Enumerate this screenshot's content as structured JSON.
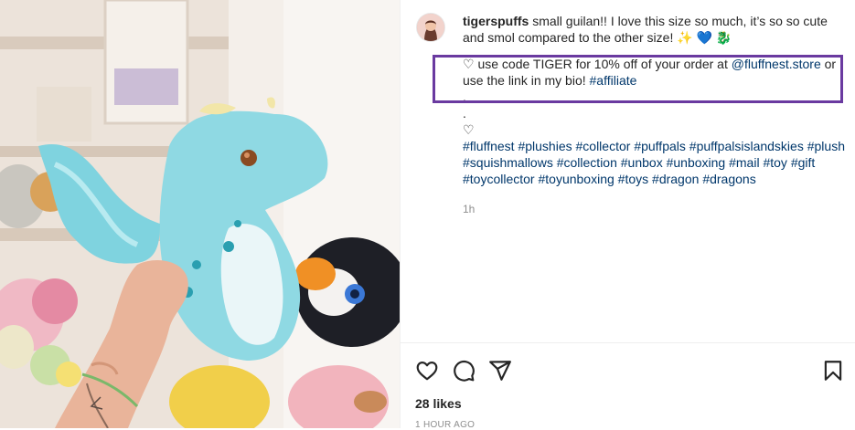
{
  "post": {
    "username": "tigerspuffs",
    "caption_text": "small guilan!! I love this size so much, it’s so so cute and smol compared to the other size! ✨ 💙 🐉",
    "promo_prefix": "♡ use code TIGER for 10% off of your order at ",
    "promo_mention": "@fluffnest.store",
    "promo_middle": " or use the link in my bio! ",
    "promo_hashtag": "#affiliate",
    "dot1": ".",
    "dot2": ".",
    "heart_line": "♡",
    "hashtags": [
      "#fluffnest",
      "#plushies",
      "#collector",
      "#puffpals",
      "#puffpalsislandskies",
      "#plush",
      "#squishmallows",
      "#collection",
      "#unbox",
      "#unboxing",
      "#mail",
      "#toy",
      "#gift",
      "#toycollector",
      "#toyunboxing",
      "#toys",
      "#dragon",
      "#dragons"
    ],
    "time_ago": "1h",
    "likes": "28 likes",
    "posted_ago": "1 HOUR AGO"
  },
  "icons": {
    "like": "heart-icon",
    "comment": "comment-icon",
    "share": "send-icon",
    "save": "bookmark-icon"
  },
  "colors": {
    "link": "#00376b",
    "highlight_border": "#6a3aa0",
    "muted": "#8e8e8e",
    "text": "#262626"
  }
}
